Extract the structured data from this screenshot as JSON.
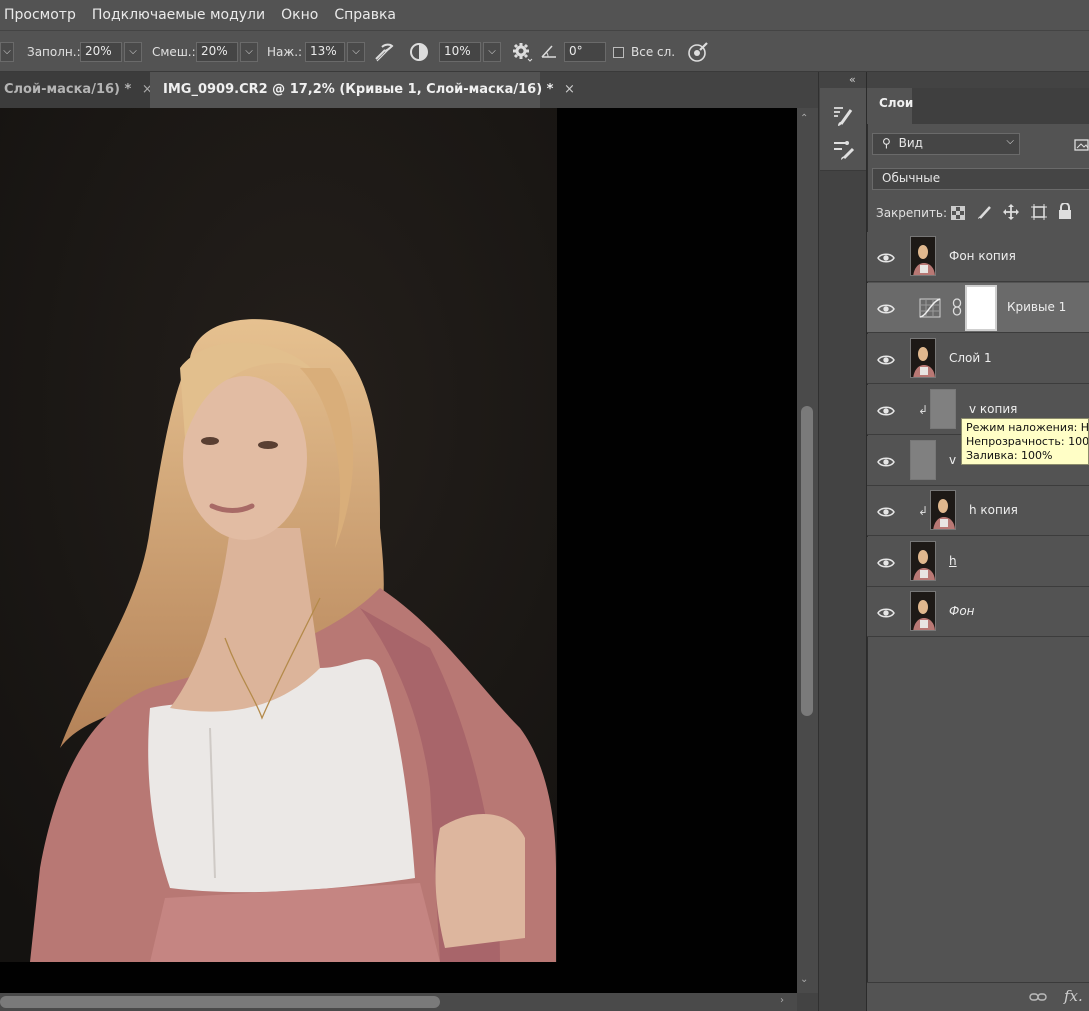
{
  "menu": {
    "items": [
      "Просмотр",
      "Подключаемые модули",
      "Окно",
      "Справка"
    ]
  },
  "options": {
    "fill_label": "Заполн.:",
    "fill_value": "20%",
    "blend_label": "Смеш.:",
    "blend_value": "20%",
    "pressure_label": "Наж.:",
    "pressure_value": "13%",
    "size_value": "10%",
    "angle_value": "0°",
    "all_layers_label": "Все сл.",
    "dropdown_glyph": "⌵"
  },
  "tabs": [
    {
      "label": "Слой-маска/16) *",
      "close": "×"
    },
    {
      "label": "IMG_0909.CR2 @ 17,2% (Кривые 1, Слой-маска/16) *",
      "close": "×"
    }
  ],
  "panel": {
    "collapse_glyph": "«",
    "tab_label": "Слои",
    "filter_label": "Вид",
    "blend_mode": "Обычные",
    "lock_label": "Закрепить:"
  },
  "layers": [
    {
      "name": "Фон копия",
      "thumb": "photo",
      "selected": false,
      "clipped": false
    },
    {
      "name": "Кривые 1",
      "thumb": "curves",
      "selected": true,
      "clipped": false
    },
    {
      "name": "Слой 1",
      "thumb": "photo",
      "selected": false,
      "clipped": false
    },
    {
      "name": "v копия",
      "thumb": "gray",
      "selected": false,
      "clipped": true
    },
    {
      "name": "v",
      "thumb": "gray",
      "selected": false,
      "clipped": false
    },
    {
      "name": "h копия",
      "thumb": "photo",
      "selected": false,
      "clipped": true
    },
    {
      "name": "h",
      "thumb": "photo",
      "selected": false,
      "clipped": false
    },
    {
      "name": "Фон",
      "thumb": "photo",
      "selected": false,
      "clipped": false,
      "italic": true
    }
  ],
  "tooltip": {
    "line1": "Режим наложения: Н",
    "line2": "Непрозрачность: 100",
    "line3": "Заливка: 100%"
  },
  "footer": {
    "link_glyph": "⊖",
    "fx_label": "fx."
  },
  "colors": {
    "ui_bg": "#535353",
    "selected_layer": "#6a6a6a",
    "tooltip_bg": "#fffec6"
  }
}
